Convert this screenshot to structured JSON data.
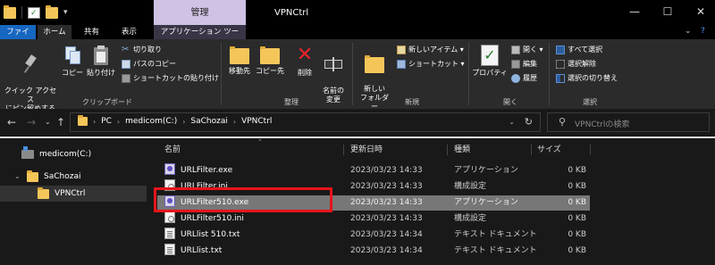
{
  "titlebar": {
    "context_tab": "管理",
    "window_title": "VPNCtrl",
    "minimize": "—",
    "maximize": "☐",
    "close": "✕"
  },
  "tabs": {
    "file": "ファイル",
    "home": "ホーム",
    "share": "共有",
    "view": "表示",
    "app_tools": "アプリケーション ツール",
    "expand": "⌄",
    "help": "?"
  },
  "ribbon": {
    "clipboard": {
      "quick_access_pin": "クイック アクセス\nにピン留めする",
      "copy": "コピー",
      "paste": "貼り付け",
      "cut": "切り取り",
      "copy_path": "パスのコピー",
      "paste_shortcut": "ショートカットの貼り付け",
      "label": "クリップボード"
    },
    "organize": {
      "move_to": "移動先",
      "copy_to": "コピー先",
      "delete": "削除",
      "rename": "名前の\n変更",
      "label": "整理"
    },
    "new": {
      "new_folder": "新しい\nフォルダー",
      "new_item": "新しいアイテム ▾",
      "shortcut": "ショートカット ▾",
      "label": "新規"
    },
    "open": {
      "properties": "プロパティ",
      "open": "開く ▾",
      "edit": "編集",
      "history": "履歴",
      "label": "開く"
    },
    "select": {
      "select_all": "すべて選択",
      "select_none": "選択解除",
      "invert": "選択の切り替え",
      "label": "選択"
    }
  },
  "address": {
    "crumbs": [
      "PC",
      "medicom(C:)",
      "SaChozai",
      "VPNCtrl"
    ],
    "search_placeholder": "VPNCtrlの検索"
  },
  "navpane": {
    "items": [
      {
        "label": "medicom(C:)"
      },
      {
        "label": "SaChozai"
      },
      {
        "label": "VPNCtrl"
      }
    ]
  },
  "filelist": {
    "headers": {
      "name": "名前",
      "modified": "更新日時",
      "type": "種類",
      "size": "サイズ"
    },
    "rows": [
      {
        "name": "URLFilter.exe",
        "modified": "2023/03/23 14:33",
        "type": "アプリケーション",
        "size": "0 KB",
        "icon": "exe"
      },
      {
        "name": "URLFilter.ini",
        "modified": "2023/03/23 14:33",
        "type": "構成設定",
        "size": "0 KB",
        "icon": "ini"
      },
      {
        "name": "URLFilter510.exe",
        "modified": "2023/03/23 14:33",
        "type": "アプリケーション",
        "size": "0 KB",
        "icon": "exe"
      },
      {
        "name": "URLFilter510.ini",
        "modified": "2023/03/23 14:33",
        "type": "構成設定",
        "size": "0 KB",
        "icon": "ini"
      },
      {
        "name": "URLlist 510.txt",
        "modified": "2023/03/23 14:34",
        "type": "テキスト ドキュメント",
        "size": "0 KB",
        "icon": "txt"
      },
      {
        "name": "URLlist.txt",
        "modified": "2023/03/23 14:34",
        "type": "テキスト ドキュメント",
        "size": "0 KB",
        "icon": "txt"
      }
    ]
  }
}
